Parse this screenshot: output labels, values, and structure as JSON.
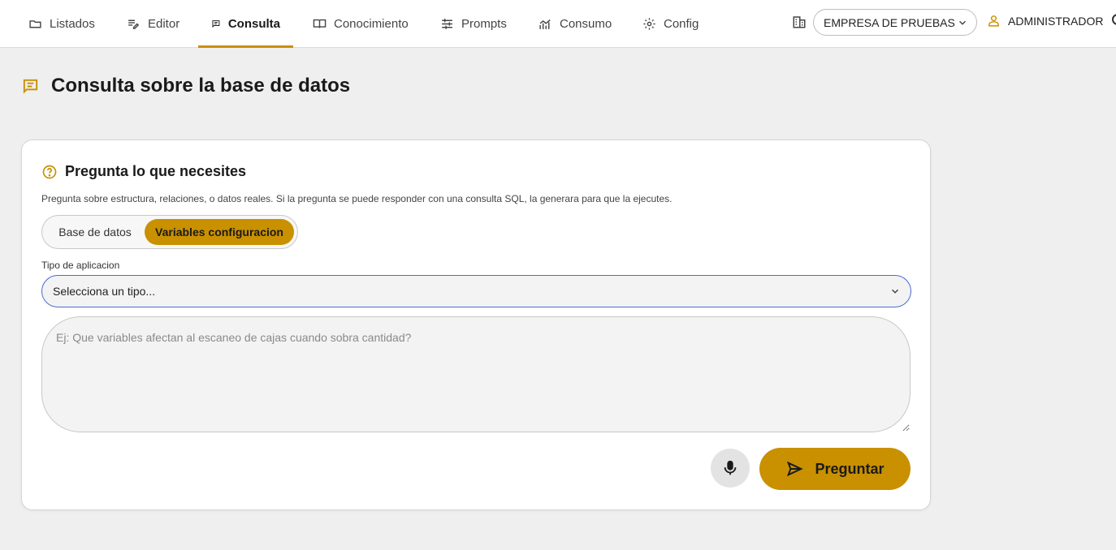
{
  "nav": {
    "tabs": [
      {
        "label": "Listados",
        "icon": "folder-icon",
        "active": false
      },
      {
        "label": "Editor",
        "icon": "edit-note-icon",
        "active": false
      },
      {
        "label": "Consulta",
        "icon": "chat-icon",
        "active": true
      },
      {
        "label": "Conocimiento",
        "icon": "book-icon",
        "active": false
      },
      {
        "label": "Prompts",
        "icon": "sliders-icon",
        "active": false
      },
      {
        "label": "Consumo",
        "icon": "chart-icon",
        "active": false
      },
      {
        "label": "Config",
        "icon": "gear-icon",
        "active": false
      }
    ],
    "company": "EMPRESA DE PRUEBAS",
    "user": "ADMINISTRADOR"
  },
  "page": {
    "title": "Consulta sobre la base de datos"
  },
  "card": {
    "title": "Pregunta lo que necesites",
    "description": "Pregunta sobre estructura, relaciones, o datos reales. Si la pregunta se puede responder con una consulta SQL, la generara para que la ejecutes.",
    "segments": [
      "Base de datos",
      "Variables configuracion"
    ],
    "active_segment": "Variables configuracion",
    "type_label": "Tipo de aplicacion",
    "type_value": "Selecciona un tipo...",
    "question_placeholder": "Ej: Que variables afectan al escaneo de cajas cuando sobra cantidad?",
    "question_value": "",
    "ask_label": "Preguntar"
  },
  "colors": {
    "accent": "#c99000",
    "focus_border": "#4a6bd1",
    "background": "#efefef"
  }
}
